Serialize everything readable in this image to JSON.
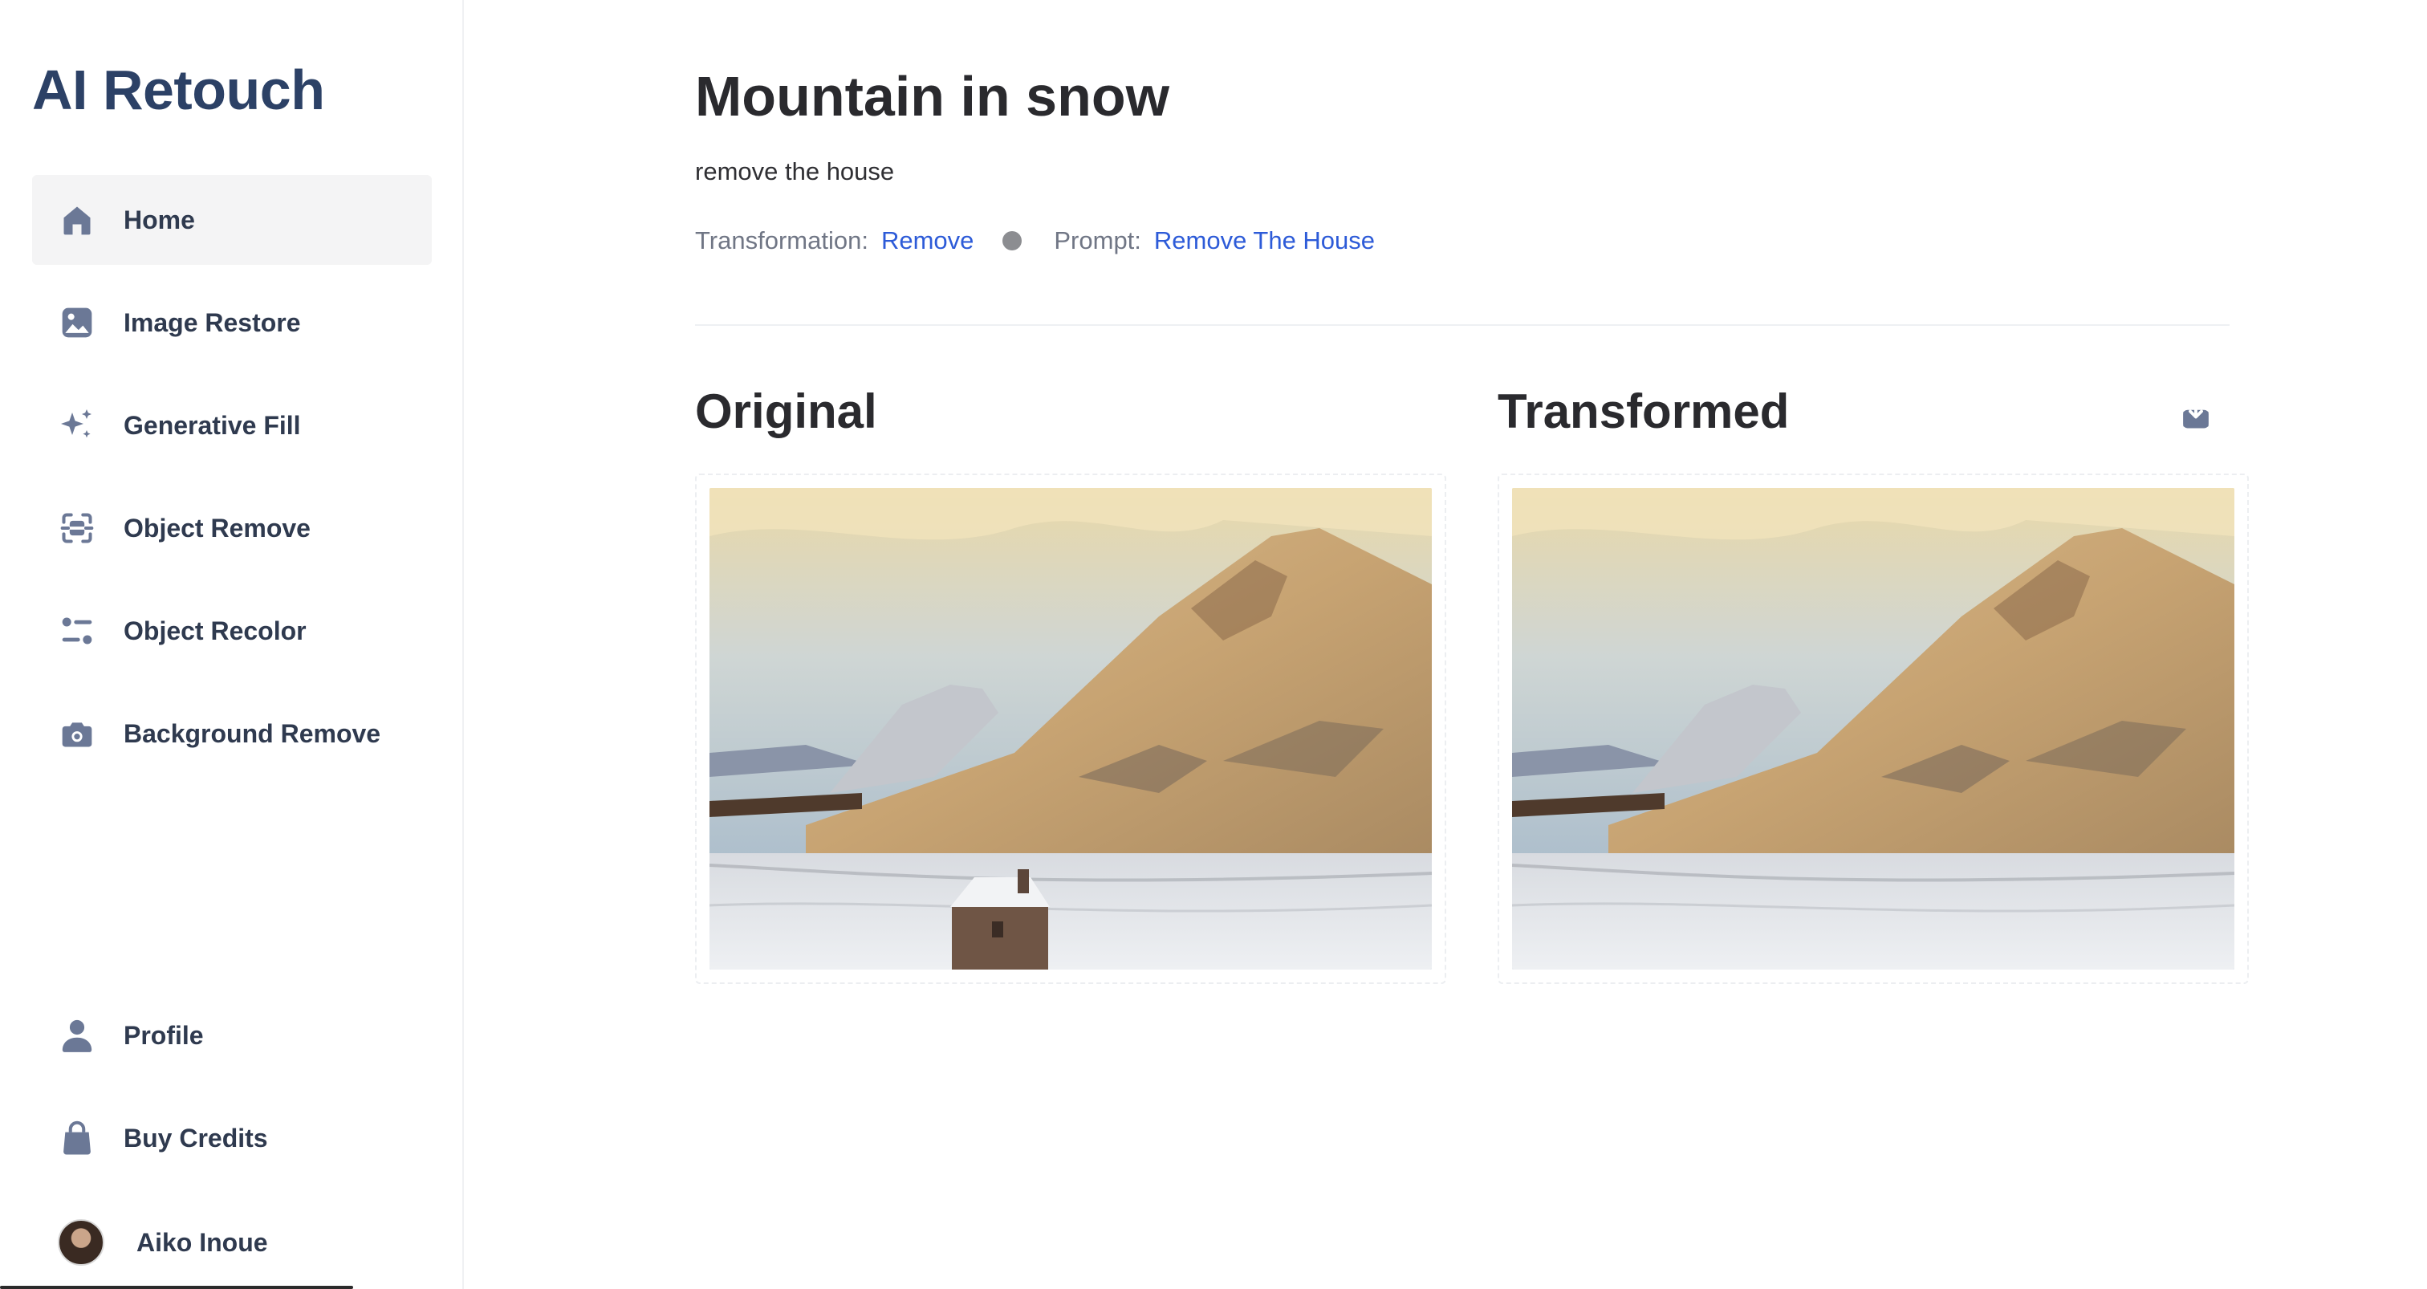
{
  "app": {
    "title": "AI Retouch"
  },
  "sidebar": {
    "items": [
      {
        "label": "Home",
        "icon": "home-icon",
        "active": true
      },
      {
        "label": "Image Restore",
        "icon": "image-icon",
        "active": false
      },
      {
        "label": "Generative Fill",
        "icon": "sparkles-icon",
        "active": false
      },
      {
        "label": "Object Remove",
        "icon": "scan-icon",
        "active": false
      },
      {
        "label": "Object Recolor",
        "icon": "sliders-icon",
        "active": false
      },
      {
        "label": "Background Remove",
        "icon": "camera-icon",
        "active": false
      }
    ],
    "bottom": [
      {
        "label": "Profile",
        "icon": "user-icon"
      },
      {
        "label": "Buy Credits",
        "icon": "bag-icon"
      }
    ],
    "user": {
      "name": "Aiko Inoue"
    }
  },
  "main": {
    "title": "Mountain in snow",
    "subtitle": "remove the house",
    "meta": {
      "transformation_label": "Transformation:",
      "transformation_value": "Remove",
      "prompt_label": "Prompt:",
      "prompt_value": "Remove The House"
    },
    "original_title": "Original",
    "transformed_title": "Transformed",
    "download_icon": "download-icon"
  },
  "colors": {
    "brand": "#2c4166",
    "link": "#2d5bd8",
    "icon": "#6b7896",
    "active_bg": "#f4f4f5"
  }
}
